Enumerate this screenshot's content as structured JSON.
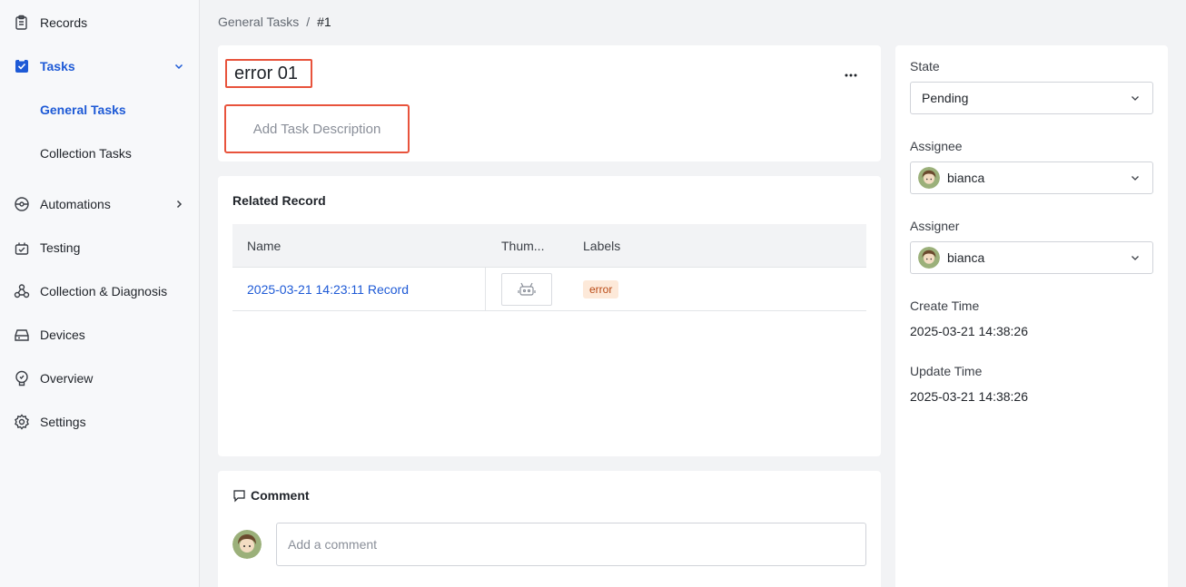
{
  "sidebar": {
    "items": [
      {
        "label": "Records",
        "icon": "records-icon"
      },
      {
        "label": "Tasks",
        "icon": "tasks-icon"
      },
      {
        "label": "Automations",
        "icon": "automations-icon"
      },
      {
        "label": "Testing",
        "icon": "testing-icon"
      },
      {
        "label": "Collection & Diagnosis",
        "icon": "collection-diagnosis-icon"
      },
      {
        "label": "Devices",
        "icon": "devices-icon"
      },
      {
        "label": "Overview",
        "icon": "overview-icon"
      },
      {
        "label": "Settings",
        "icon": "settings-icon"
      }
    ],
    "sub_items": [
      {
        "label": "General Tasks"
      },
      {
        "label": "Collection Tasks"
      }
    ],
    "accent": "#1e5ad6"
  },
  "breadcrumb": {
    "parent": "General Tasks",
    "separator": "/",
    "current": "#1"
  },
  "task": {
    "title": "error 01",
    "description_placeholder": "Add Task Description",
    "more_label": "···"
  },
  "related_record": {
    "heading": "Related Record",
    "columns": [
      "Name",
      "Thum...",
      "Labels"
    ],
    "rows": [
      {
        "name": "2025-03-21 14:23:11 Record",
        "thumbnail_icon": "robot-icon",
        "label": "error"
      }
    ]
  },
  "comment": {
    "heading": "Comment",
    "placeholder": "Add a comment"
  },
  "details": {
    "state_label": "State",
    "state_value": "Pending",
    "assignee_label": "Assignee",
    "assignee_value": "bianca",
    "assigner_label": "Assigner",
    "assigner_value": "bianca",
    "create_time_label": "Create Time",
    "create_time_value": "2025-03-21 14:38:26",
    "update_time_label": "Update Time",
    "update_time_value": "2025-03-21 14:38:26"
  },
  "colors": {
    "highlight_border": "#e8533c",
    "tag_bg": "#fde9d9",
    "tag_text": "#b94a16"
  }
}
